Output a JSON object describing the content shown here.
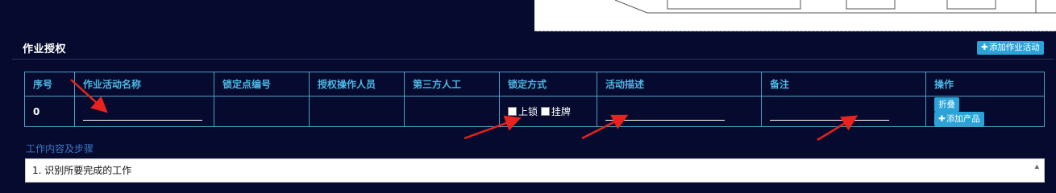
{
  "section": {
    "title": "作业授权",
    "add_activity_button": "添加作业活动"
  },
  "table": {
    "headers": [
      "序号",
      "作业活动名称",
      "锁定点编号",
      "授权操作人员",
      "第三方人工",
      "锁定方式",
      "活动描述",
      "备注",
      "操作"
    ],
    "row": {
      "index": "0",
      "activity_name_value": "",
      "description_value": "",
      "remark_value": "",
      "lock_options": [
        "上锁",
        "挂牌"
      ]
    },
    "actions": {
      "collapse_label": "折叠",
      "add_product_label": "添加产品"
    }
  },
  "steps": {
    "label": "工作内容及步骤",
    "first_line": "1. 识别所要完成的工作"
  },
  "colors": {
    "background": "#050a2e",
    "accent": "#29a3d8",
    "header_text": "#4db8e6",
    "annotation_arrow": "#e8221e"
  },
  "icons": [
    "plus-icon",
    "checkbox-icon",
    "annotation-arrow-icon",
    "scroll-up-icon"
  ]
}
